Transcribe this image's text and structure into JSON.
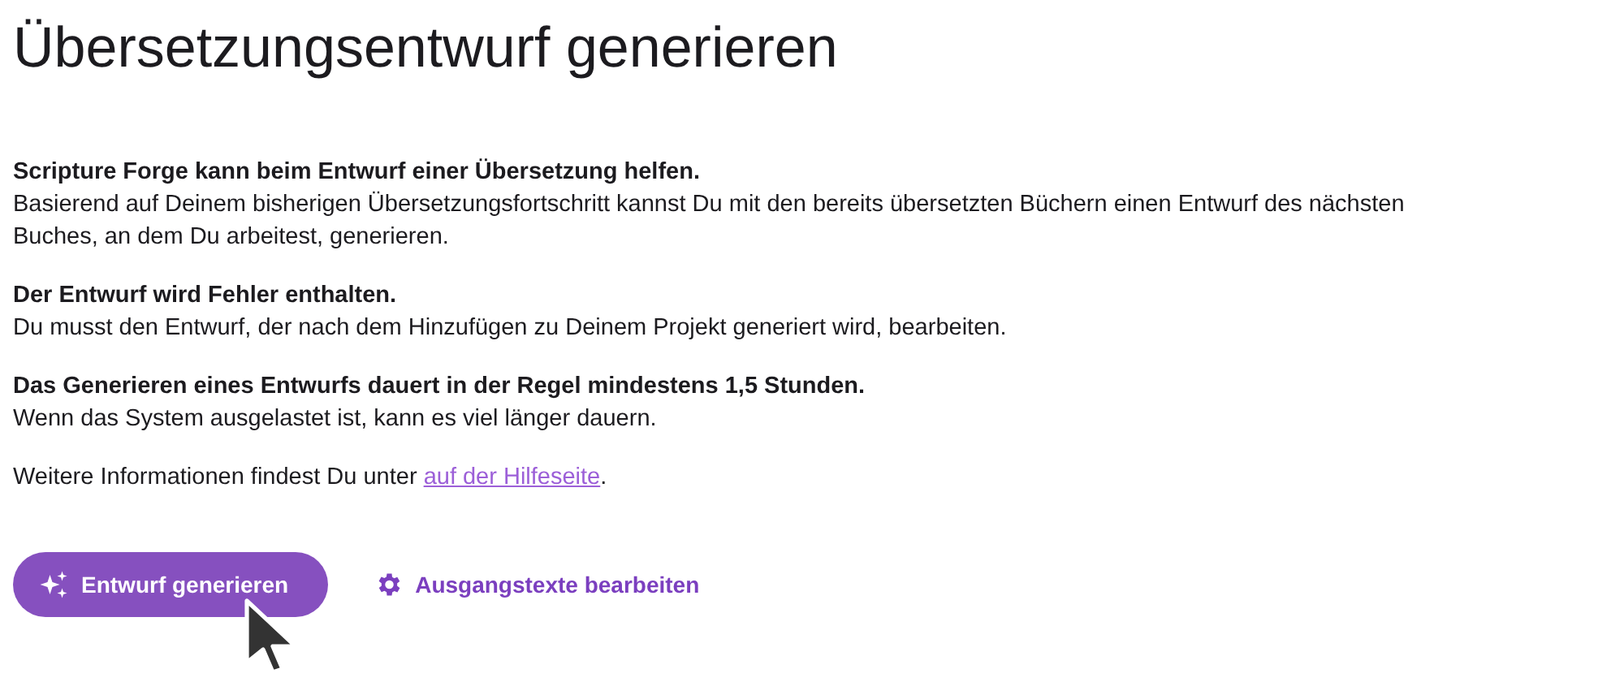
{
  "title": "Übersetzungsentwurf generieren",
  "sections": [
    {
      "heading": "Scripture Forge kann beim Entwurf einer Übersetzung helfen.",
      "body": "Basierend auf Deinem bisherigen Übersetzungsfortschritt kannst Du mit den bereits übersetzten Büchern einen Entwurf des nächsten Buches, an dem Du arbeitest, generieren."
    },
    {
      "heading": "Der Entwurf wird Fehler enthalten.",
      "body": "Du musst den Entwurf, der nach dem Hinzufügen zu Deinem Projekt generiert wird, bearbeiten."
    },
    {
      "heading": "Das Generieren eines Entwurfs dauert in der Regel mindestens 1,5 Stunden.",
      "body": "Wenn das System ausgelastet ist, kann es viel länger dauern."
    }
  ],
  "more_info": {
    "text": "Weitere Informationen findest Du unter",
    "link": "auf der Hilfeseite",
    "suffix": "."
  },
  "actions": [
    {
      "kind": "primary",
      "label": "Entwurf generieren"
    },
    {
      "kind": "link",
      "label": "Ausgangstexte bearbeiten"
    }
  ]
}
